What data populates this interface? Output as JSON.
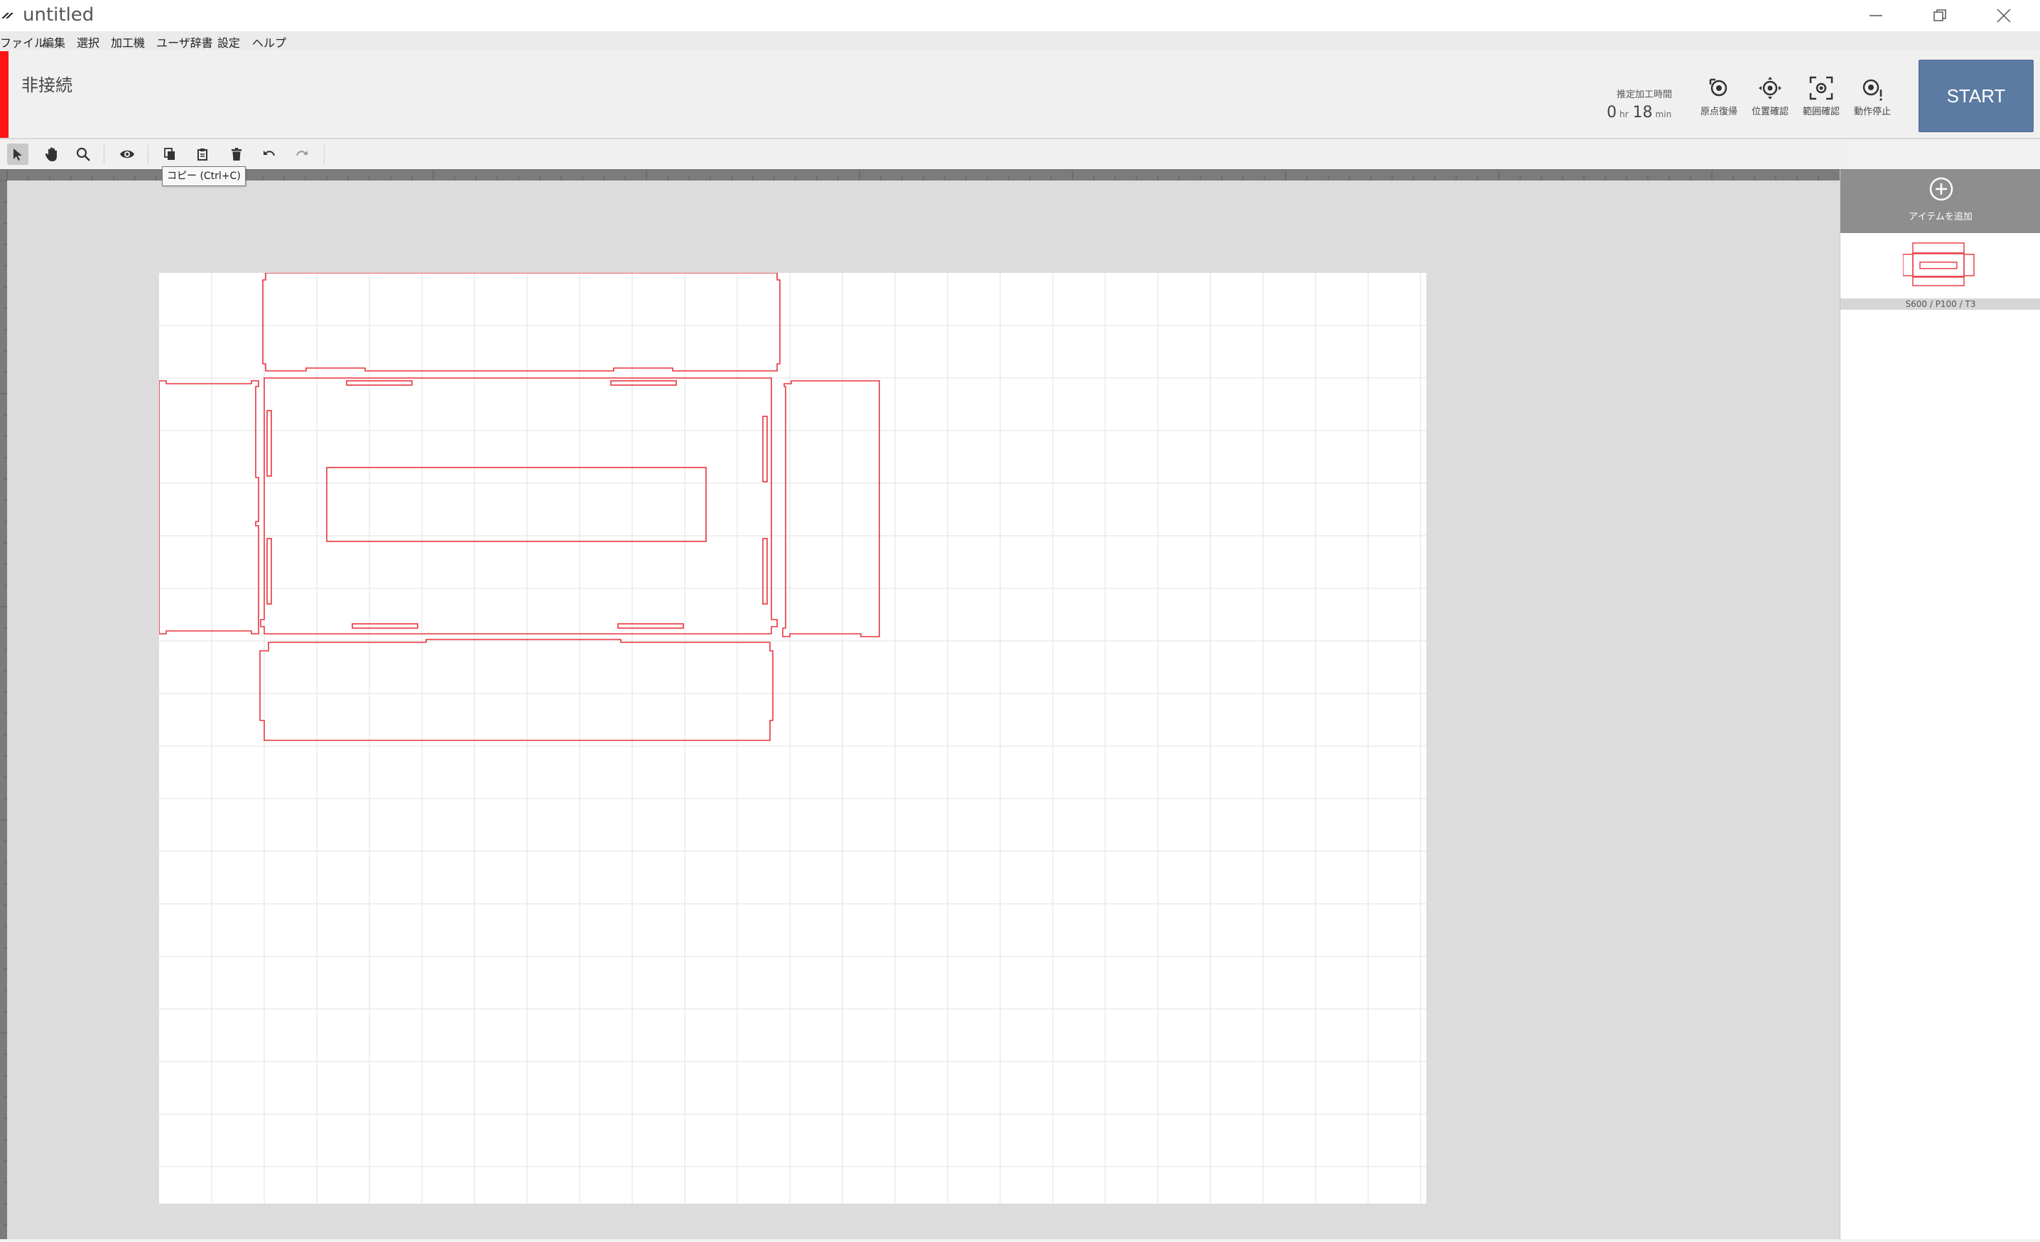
{
  "window": {
    "title": "untitled",
    "logo_icon": "app-logo-icon"
  },
  "menu": {
    "items": [
      "ファイル",
      "編集",
      "選択",
      "加工機",
      "ユーザ辞書",
      "設定",
      "ヘルプ"
    ]
  },
  "status": {
    "connection": "非接続",
    "color": "#ff1414"
  },
  "estimate": {
    "label": "推定加工時間",
    "hours": "0",
    "hours_unit": "hr",
    "minutes": "18",
    "minutes_unit": "min"
  },
  "machine_tools": [
    {
      "label": "原点復帰",
      "icon": "home-origin-icon"
    },
    {
      "label": "位置確認",
      "icon": "position-check-icon"
    },
    {
      "label": "範囲確認",
      "icon": "range-check-icon"
    },
    {
      "label": "動作停止",
      "icon": "stop-icon"
    }
  ],
  "start_button": {
    "label": "START",
    "color": "#5c7ba3"
  },
  "toolbar": {
    "tools": [
      "select-tool-icon",
      "pan-hand-icon",
      "zoom-icon",
      "preview-eye-icon",
      "copy-icon",
      "paste-icon",
      "delete-icon",
      "undo-icon",
      "redo-icon"
    ],
    "active_tool": "select",
    "tooltip": "コピー (Ctrl+C)"
  },
  "right_panel": {
    "add_item_label": "アイテムを追加",
    "item_caption": "S600 / P100 / T3"
  },
  "colors": {
    "cut_line": "#e8343c",
    "canvas_bg": "#dcdcdc",
    "sheet_bg": "#ffffff",
    "grid": "#e6e6e6"
  }
}
